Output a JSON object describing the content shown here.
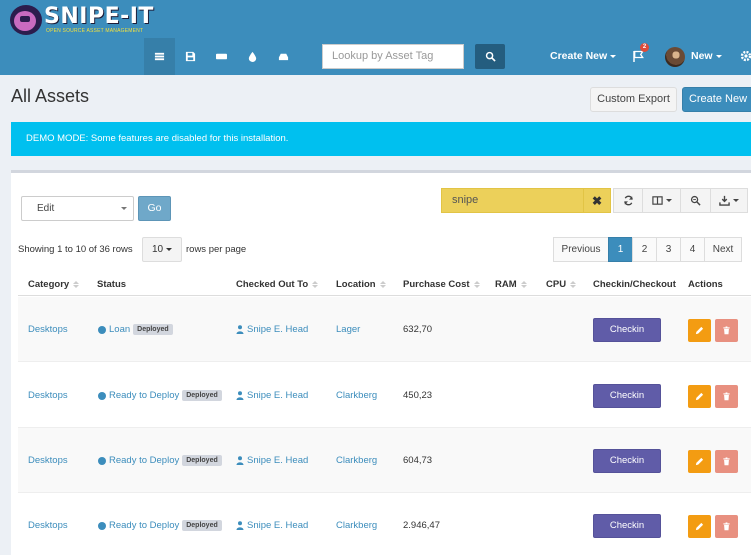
{
  "app": {
    "name": "SNIPE-IT",
    "tagline": "OPEN SOURCE ASSET MANAGEMENT",
    "brand_color": "#3c8dbc"
  },
  "navbar": {
    "icons": [
      {
        "name": "assets-list-icon",
        "active": true
      },
      {
        "name": "licenses-save-icon",
        "active": false
      },
      {
        "name": "accessories-keyboard-icon",
        "active": false
      },
      {
        "name": "consumables-drop-icon",
        "active": false
      },
      {
        "name": "components-drive-icon",
        "active": false
      }
    ],
    "search_placeholder": "Lookup by Asset Tag",
    "create_new_label": "Create New",
    "alerts_count": "2",
    "user_label": "New"
  },
  "page": {
    "title": "All Assets",
    "custom_export_label": "Custom Export",
    "create_new_label": "Create New",
    "demo_notice": "DEMO MODE: Some features are disabled for this installation."
  },
  "toolbar": {
    "bulk_action": "Edit",
    "go_label": "Go",
    "search_value": "snipe",
    "clear_symbol": "✖"
  },
  "pagination": {
    "showing_text": "Showing 1 to 10 of 36 rows",
    "per_page": "10",
    "rows_per_page_text": "rows per page",
    "previous_label": "Previous",
    "pages": [
      "1",
      "2",
      "3",
      "4"
    ],
    "active_page": "1",
    "next_label": "Next"
  },
  "table": {
    "headers": {
      "category": "Category",
      "status": "Status",
      "checked_out_to": "Checked Out To",
      "location": "Location",
      "purchase_cost": "Purchase Cost",
      "ram": "RAM",
      "cpu": "CPU",
      "checkin_checkout": "Checkin/Checkout",
      "actions": "Actions"
    },
    "rows": [
      {
        "category": "Desktops",
        "status": "Loan",
        "status_label": "Deployed",
        "checked_out_to": "Snipe E. Head",
        "location": "Lager",
        "purchase_cost": "632,70",
        "ram": "",
        "cpu": "",
        "checkin_label": "Checkin"
      },
      {
        "category": "Desktops",
        "status": "Ready to Deploy",
        "status_label": "Deployed",
        "checked_out_to": "Snipe E. Head",
        "location": "Clarkberg",
        "purchase_cost": "450,23",
        "ram": "",
        "cpu": "",
        "checkin_label": "Checkin"
      },
      {
        "category": "Desktops",
        "status": "Ready to Deploy",
        "status_label": "Deployed",
        "checked_out_to": "Snipe E. Head",
        "location": "Clarkberg",
        "purchase_cost": "604,73",
        "ram": "",
        "cpu": "",
        "checkin_label": "Checkin"
      },
      {
        "category": "Desktops",
        "status": "Ready to Deploy",
        "status_label": "Deployed",
        "checked_out_to": "Snipe E. Head",
        "location": "Clarkberg",
        "purchase_cost": "2.946,47",
        "ram": "",
        "cpu": "",
        "checkin_label": "Checkin"
      }
    ]
  }
}
